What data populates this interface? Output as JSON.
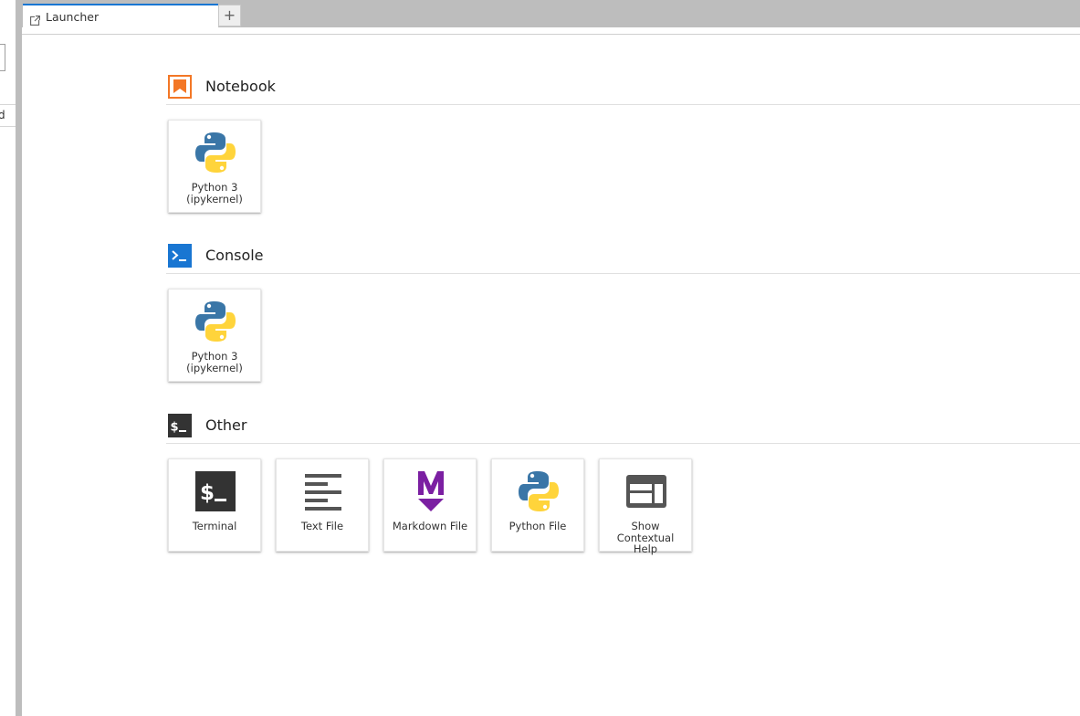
{
  "sidebar": {
    "row_fragment": "d"
  },
  "tabs": [
    {
      "label": "Launcher"
    }
  ],
  "add_tab_label": "+",
  "sections": {
    "notebook": {
      "title": "Notebook",
      "items": [
        {
          "label": "Python 3\n(ipykernel)",
          "icon": "python-logo-icon"
        }
      ]
    },
    "console": {
      "title": "Console",
      "items": [
        {
          "label": "Python 3\n(ipykernel)",
          "icon": "python-logo-icon"
        }
      ]
    },
    "other": {
      "title": "Other",
      "items": [
        {
          "label": "Terminal",
          "icon": "terminal-icon"
        },
        {
          "label": "Text File",
          "icon": "text-file-icon"
        },
        {
          "label": "Markdown File",
          "icon": "markdown-icon"
        },
        {
          "label": "Python File",
          "icon": "python-logo-icon"
        },
        {
          "label": "Show Contextual\nHelp",
          "icon": "contextual-help-icon"
        }
      ]
    }
  },
  "colors": {
    "notebook_orange": "#f37726",
    "console_blue": "#1976d2",
    "terminal_dark": "#333333",
    "markdown_purple": "#7b1fa2",
    "python_blue": "#3a76a7",
    "python_yellow": "#ffd43b",
    "active_tab_border": "#1976d2",
    "tabbar_bg": "#bdbdbd"
  }
}
